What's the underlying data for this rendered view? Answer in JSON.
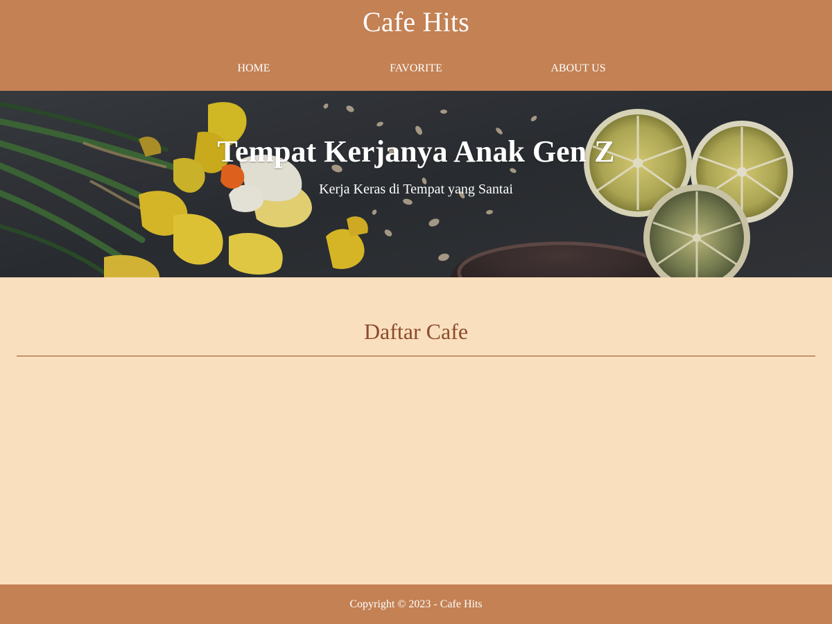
{
  "header": {
    "site_title": "Cafe Hits",
    "nav": [
      {
        "label": "HOME"
      },
      {
        "label": "FAVORITE"
      },
      {
        "label": "ABOUT US"
      }
    ]
  },
  "hero": {
    "title": "Tempat Kerjanya Anak Gen Z",
    "subtitle": "Kerja Keras di Tempat yang Santai"
  },
  "main": {
    "heading": "Daftar Cafe"
  },
  "footer": {
    "copyright": "Copyright © 2023 - Cafe Hits"
  },
  "colors": {
    "header_bg": "#c38154",
    "page_bg": "#f9dfbd",
    "heading_text": "#8b4a2e",
    "divider": "#9b4a2c",
    "footer_bg": "#c38154"
  }
}
